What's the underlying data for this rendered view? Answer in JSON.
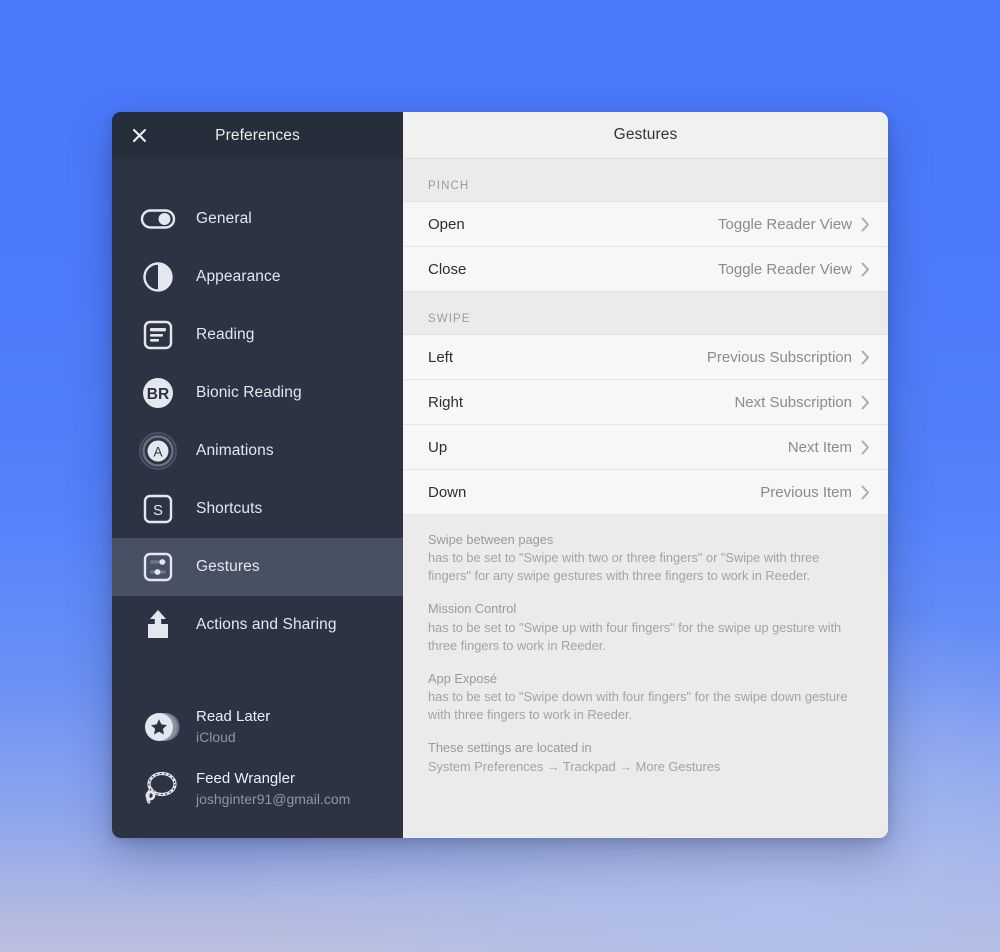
{
  "window": {
    "close_icon": "close-icon",
    "sidebar_title": "Preferences",
    "detail_title": "Gestures"
  },
  "sidebar": {
    "items": [
      {
        "label": "General",
        "icon": "toggle-switch-icon",
        "selected": false
      },
      {
        "label": "Appearance",
        "icon": "half-circle-icon",
        "selected": false
      },
      {
        "label": "Reading",
        "icon": "document-lines-icon",
        "selected": false
      },
      {
        "label": "Bionic Reading",
        "icon": "br-badge-icon",
        "selected": false
      },
      {
        "label": "Animations",
        "icon": "a-rings-icon",
        "selected": false
      },
      {
        "label": "Shortcuts",
        "icon": "s-key-icon",
        "selected": false
      },
      {
        "label": "Gestures",
        "icon": "sliders-icon",
        "selected": true
      },
      {
        "label": "Actions and Sharing",
        "icon": "share-up-icon",
        "selected": false
      }
    ],
    "accounts": [
      {
        "name": "Read Later",
        "sub": "iCloud",
        "icon": "star-stack-icon"
      },
      {
        "name": "Feed Wrangler",
        "sub": "joshginter91@gmail.com",
        "icon": "lasso-rope-icon"
      }
    ]
  },
  "detail": {
    "sections": [
      {
        "header": "PINCH",
        "rows": [
          {
            "label": "Open",
            "value": "Toggle Reader View",
            "chevron": "chevron-right-icon"
          },
          {
            "label": "Close",
            "value": "Toggle Reader View",
            "chevron": "chevron-right-icon"
          }
        ]
      },
      {
        "header": "SWIPE",
        "rows": [
          {
            "label": "Left",
            "value": "Previous Subscription",
            "chevron": "chevron-right-icon"
          },
          {
            "label": "Right",
            "value": "Next Subscription",
            "chevron": "chevron-right-icon"
          },
          {
            "label": "Up",
            "value": "Next Item",
            "chevron": "chevron-right-icon"
          },
          {
            "label": "Down",
            "value": "Previous Item",
            "chevron": "chevron-right-icon"
          }
        ]
      }
    ],
    "help": [
      {
        "title": "Swipe between pages",
        "text": "has to be set to \"Swipe with two or three fingers\" or \"Swipe with three fingers\" for any swipe gestures with three fingers to work in Reeder."
      },
      {
        "title": "Mission Control",
        "text": "has to be set to \"Swipe up with four fingers\" for the swipe up gesture with three fingers to work in Reeder."
      },
      {
        "title": "App Exposé",
        "text": "has to be set to \"Swipe down with four fingers\" for the swipe down gesture with three fingers to work in Reeder."
      },
      {
        "title": "These settings are located in",
        "text": "System Preferences → Trackpad → More Gestures"
      }
    ]
  },
  "colors": {
    "sidebar_bg": "#2c3443",
    "sidebar_header_bg": "#262d3b",
    "sidebar_selected_bg": "#475163",
    "detail_bg": "#f7f7f7",
    "section_bg": "#ebebeb",
    "desktop_accent": "#4a79fc"
  }
}
